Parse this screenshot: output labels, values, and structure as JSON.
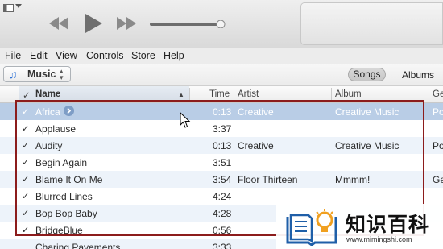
{
  "menu": [
    "File",
    "Edit",
    "View",
    "Controls",
    "Store",
    "Help"
  ],
  "library": {
    "label": "Music",
    "icon": "music-note-icon"
  },
  "view_tabs": {
    "songs": "Songs",
    "albums": "Albums"
  },
  "columns": {
    "check": "✓",
    "name": "Name",
    "sort_indicator": "▲",
    "time": "Time",
    "artist": "Artist",
    "album": "Album",
    "genre": "Ge"
  },
  "rows": [
    {
      "check": "✓",
      "name": "Africa",
      "time": "0:13",
      "artist": "Creative",
      "album": "Creative Music",
      "genre": "Po",
      "selected": true
    },
    {
      "check": "✓",
      "name": "Applause",
      "time": "3:37",
      "artist": "",
      "album": "",
      "genre": ""
    },
    {
      "check": "✓",
      "name": "Audity",
      "time": "0:13",
      "artist": "Creative",
      "album": "Creative Music",
      "genre": "Po"
    },
    {
      "check": "✓",
      "name": "Begin Again",
      "time": "3:51",
      "artist": "",
      "album": "",
      "genre": ""
    },
    {
      "check": "✓",
      "name": "Blame It On Me",
      "time": "3:54",
      "artist": "Floor Thirteen",
      "album": "Mmmm!",
      "genre": "Ge"
    },
    {
      "check": "✓",
      "name": "Blurred Lines",
      "time": "4:24",
      "artist": "",
      "album": "",
      "genre": ""
    },
    {
      "check": "✓",
      "name": "Bop Bop Baby",
      "time": "4:28",
      "artist": "",
      "album": "",
      "genre": ""
    },
    {
      "check": "✓",
      "name": "BridgeBlue",
      "time": "0:56",
      "artist": "",
      "album": "",
      "genre": ""
    },
    {
      "check": "",
      "name": "Charing Pavements",
      "time": "3:33",
      "artist": "",
      "album": "",
      "genre": ""
    }
  ],
  "watermark": {
    "title": "知识百科",
    "url": "www.mimingshi.com"
  },
  "colors": {
    "selected_row": "#b9cde6",
    "alt_row": "#edf3fa",
    "highlight_box": "#8c1c1c",
    "accent": "#2a6fd6"
  }
}
